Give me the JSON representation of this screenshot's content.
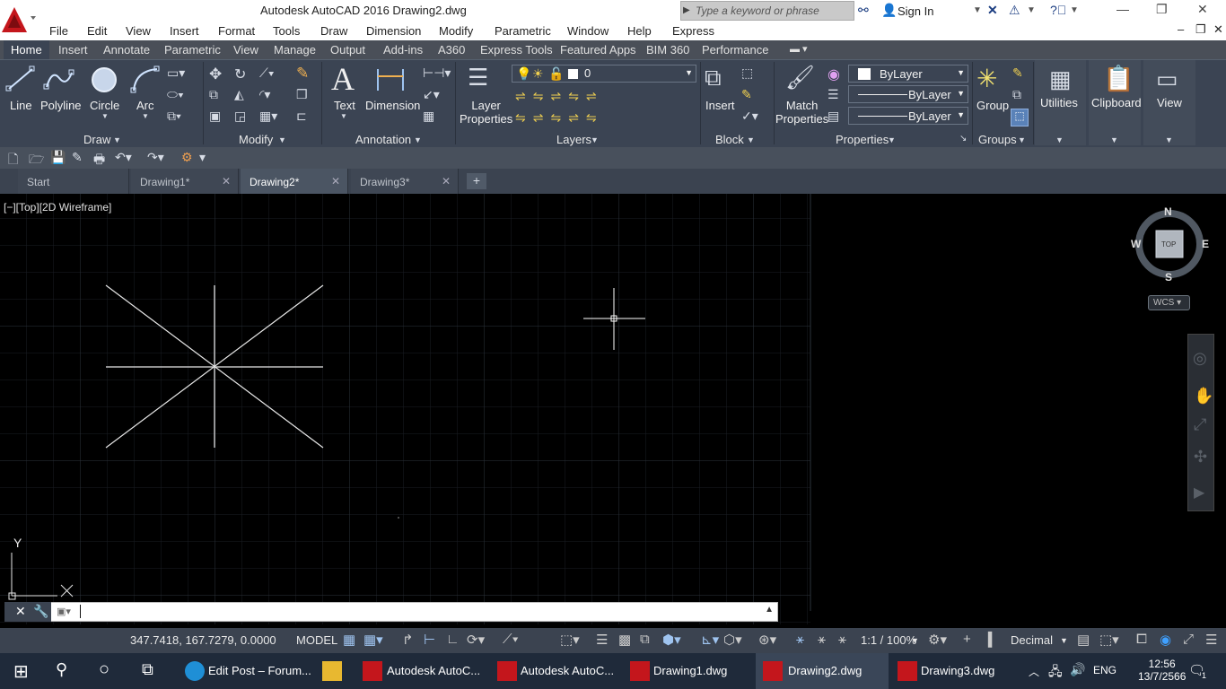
{
  "window": {
    "title": "Autodesk AutoCAD 2016    Drawing2.dwg"
  },
  "search": {
    "placeholder": "Type a keyword or phrase"
  },
  "signin": "Sign In",
  "menubar": [
    "File",
    "Edit",
    "View",
    "Insert",
    "Format",
    "Tools",
    "Draw",
    "Dimension",
    "Modify",
    "Parametric",
    "Window",
    "Help",
    "Express"
  ],
  "ribbon_tabs": [
    "Home",
    "Insert",
    "Annotate",
    "Parametric",
    "View",
    "Manage",
    "Output",
    "Add-ins",
    "A360",
    "Express Tools",
    "Featured Apps",
    "BIM 360",
    "Performance"
  ],
  "ribbon": {
    "draw": {
      "title": "Draw",
      "line": "Line",
      "polyline": "Polyline",
      "circle": "Circle",
      "arc": "Arc"
    },
    "modify": {
      "title": "Modify"
    },
    "annotation": {
      "title": "Annotation",
      "text": "Text",
      "dimension": "Dimension"
    },
    "layers": {
      "title": "Layers",
      "layer_properties": "Layer\nProperties",
      "current_layer": "0"
    },
    "block": {
      "title": "Block",
      "insert": "Insert"
    },
    "properties": {
      "title": "Properties",
      "match": "Match\nProperties",
      "color": "ByLayer",
      "linetype": "ByLayer",
      "lineweight": "ByLayer"
    },
    "groups": {
      "title": "Groups",
      "group": "Group"
    },
    "utilities": {
      "label": "Utilities"
    },
    "clipboard": {
      "label": "Clipboard"
    },
    "view": {
      "label": "View"
    }
  },
  "file_tabs": [
    {
      "label": "Start"
    },
    {
      "label": "Drawing1*"
    },
    {
      "label": "Drawing2*"
    },
    {
      "label": "Drawing3*"
    }
  ],
  "active_file_tab": "Drawing2*",
  "viewport_label": "[−][Top][2D Wireframe]",
  "viewcube": {
    "n": "N",
    "s": "S",
    "e": "E",
    "w": "W",
    "face": "TOP",
    "wcs": "WCS"
  },
  "ucs": {
    "y": "Y"
  },
  "status": {
    "coords": "347.7418, 167.7279, 0.0000",
    "model": "MODEL",
    "scale": "1:1 / 100%",
    "units": "Decimal"
  },
  "taskbar": {
    "items": [
      "Edit Post – Forum...",
      "Autodesk AutoC...",
      "Autodesk AutoC...",
      "Drawing1.dwg",
      "Drawing2.dwg",
      "Drawing3.dwg"
    ],
    "lang": "ENG",
    "time": "12:56",
    "date": "13/7/2566",
    "notification_count": "1"
  },
  "colors": {
    "accent": "#c4161c",
    "ribbon": "#3b4453",
    "canvas": "#000000"
  }
}
